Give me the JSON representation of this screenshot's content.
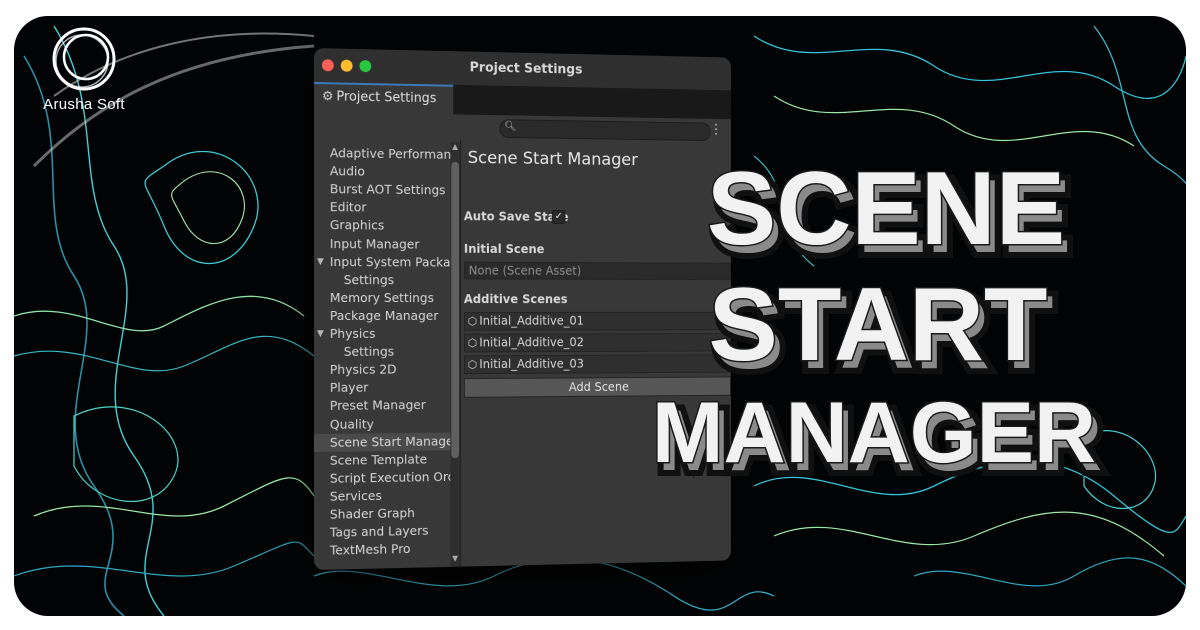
{
  "brand": {
    "name": "Arusha Soft"
  },
  "window": {
    "title": "Project Settings",
    "tab_label": "Project Settings",
    "search_placeholder": ""
  },
  "sidebar": {
    "items": [
      {
        "label": "Adaptive Performance",
        "level": 0
      },
      {
        "label": "Audio",
        "level": 0
      },
      {
        "label": "Burst AOT Settings",
        "level": 0
      },
      {
        "label": "Editor",
        "level": 0
      },
      {
        "label": "Graphics",
        "level": 0
      },
      {
        "label": "Input Manager",
        "level": 0
      },
      {
        "label": "Input System Package",
        "level": 0,
        "expanded": true
      },
      {
        "label": "Settings",
        "level": 1
      },
      {
        "label": "Memory Settings",
        "level": 0
      },
      {
        "label": "Package Manager",
        "level": 0
      },
      {
        "label": "Physics",
        "level": 0,
        "expanded": true
      },
      {
        "label": "Settings",
        "level": 1
      },
      {
        "label": "Physics 2D",
        "level": 0
      },
      {
        "label": "Player",
        "level": 0
      },
      {
        "label": "Preset Manager",
        "level": 0
      },
      {
        "label": "Quality",
        "level": 0
      },
      {
        "label": "Scene Start Manager",
        "level": 0,
        "selected": true
      },
      {
        "label": "Scene Template",
        "level": 0
      },
      {
        "label": "Script Execution Order",
        "level": 0
      },
      {
        "label": "Services",
        "level": 0
      },
      {
        "label": "Shader Graph",
        "level": 0
      },
      {
        "label": "Tags and Layers",
        "level": 0
      },
      {
        "label": "TextMesh Pro",
        "level": 0
      }
    ]
  },
  "content": {
    "heading": "Scene Start Manager",
    "auto_save_label": "Auto Save State",
    "auto_save_checked": true,
    "initial_scene_label": "Initial Scene",
    "initial_scene_value": "None (Scene Asset)",
    "additive_label": "Additive Scenes",
    "additive_scenes": [
      "Initial_Additive_01",
      "Initial_Additive_02",
      "Initial_Additive_03"
    ],
    "add_button": "Add Scene"
  },
  "hero": {
    "lines": [
      "SCENE",
      "START",
      "MANAGER"
    ]
  },
  "colors": {
    "background": "#020304",
    "contour_cyan": "#35c3d9",
    "contour_green": "#9be7a6",
    "hero_text": "#f2f2f2",
    "hero_shadow": "#8a8a8a"
  }
}
